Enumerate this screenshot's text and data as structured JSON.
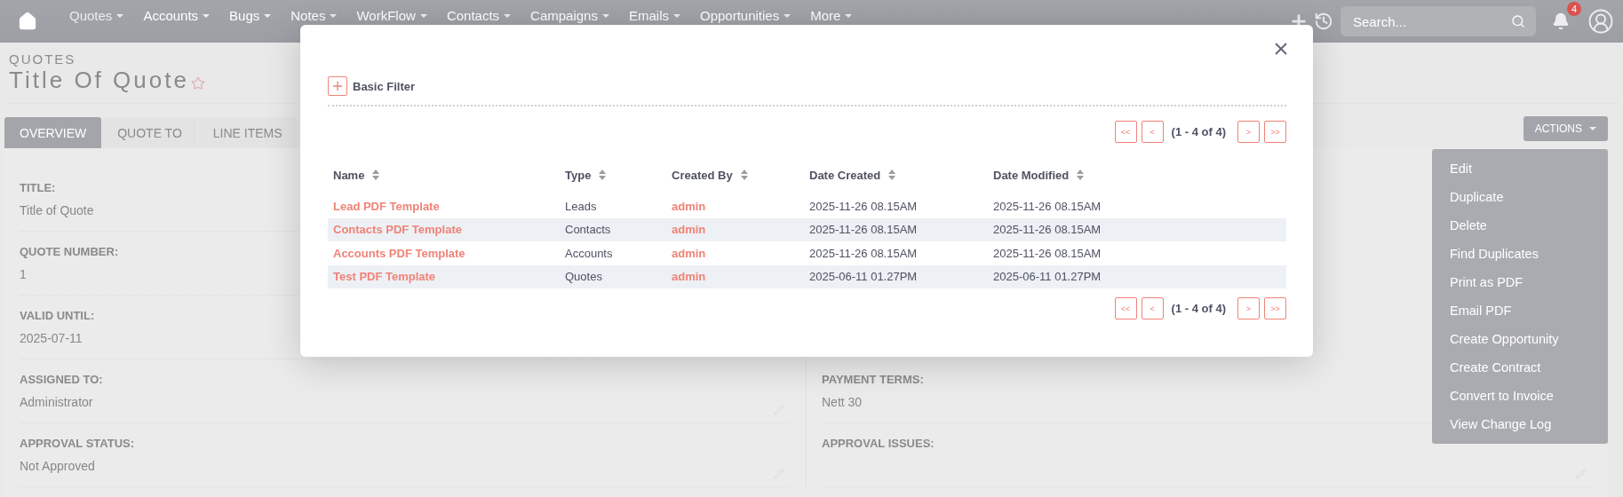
{
  "nav": {
    "items": [
      {
        "label": "Quotes",
        "selected": true
      },
      {
        "label": "Accounts",
        "selected": false
      },
      {
        "label": "Bugs",
        "selected": false
      },
      {
        "label": "Notes",
        "selected": false
      },
      {
        "label": "WorkFlow",
        "selected": false
      },
      {
        "label": "Contacts",
        "selected": false
      },
      {
        "label": "Campaigns",
        "selected": false
      },
      {
        "label": "Emails",
        "selected": false
      },
      {
        "label": "Opportunities",
        "selected": false
      },
      {
        "label": "More",
        "selected": false
      }
    ],
    "search": {
      "placeholder": "Search..."
    },
    "notification_count": "4"
  },
  "header": {
    "module": "QUOTES",
    "title": "Title Of Quote"
  },
  "tabs": [
    {
      "label": "OVERVIEW",
      "selected": true
    },
    {
      "label": "QUOTE TO",
      "selected": false
    },
    {
      "label": "LINE ITEMS",
      "selected": false
    }
  ],
  "actions": {
    "label": "ACTIONS",
    "menu": [
      "Edit",
      "Duplicate",
      "Delete",
      "Find Duplicates",
      "Print as PDF",
      "Email PDF",
      "Create Opportunity",
      "Create Contract",
      "Convert to Invoice",
      "View Change Log"
    ]
  },
  "fields_left": [
    {
      "label": "TITLE:",
      "value": "Title of Quote"
    },
    {
      "label": "QUOTE NUMBER:",
      "value": "1"
    },
    {
      "label": "VALID UNTIL:",
      "value": "2025-07-11"
    },
    {
      "label": "ASSIGNED TO:",
      "value": "Administrator",
      "editable": true
    },
    {
      "label": "APPROVAL STATUS:",
      "value": "Not Approved",
      "editable": true
    }
  ],
  "fields_right": [
    {
      "label": "PAYMENT TERMS:",
      "value": "Nett 30"
    },
    {
      "label": "APPROVAL ISSUES:",
      "editable": true
    }
  ],
  "modal": {
    "filter_label": "Basic Filter",
    "pagination_top": {
      "first": "<<",
      "prev": "<",
      "range": "(1 - 4 of 4)",
      "next": ">",
      "last": ">>"
    },
    "columns": [
      "Name",
      "Type",
      "Created By",
      "Date Created",
      "Date Modified"
    ],
    "rows": [
      {
        "name": "Lead PDF Template",
        "type": "Leads",
        "created_by": "admin",
        "date_created": "2025-11-26 08.15AM",
        "date_modified": "2025-11-26 08.15AM"
      },
      {
        "name": "Contacts PDF Template",
        "type": "Contacts",
        "created_by": "admin",
        "date_created": "2025-11-26 08.15AM",
        "date_modified": "2025-11-26 08.15AM"
      },
      {
        "name": "Accounts PDF Template",
        "type": "Accounts",
        "created_by": "admin",
        "date_created": "2025-11-26 08.15AM",
        "date_modified": "2025-11-26 08.15AM"
      },
      {
        "name": "Test PDF Template",
        "type": "Quotes",
        "created_by": "admin",
        "date_created": "2025-06-11 01.27PM",
        "date_modified": "2025-06-11 01.27PM"
      }
    ],
    "pagination_bottom": {
      "first": "<<",
      "prev": "<",
      "range": "(1 - 4 of 4)",
      "next": ">",
      "last": ">>"
    }
  }
}
